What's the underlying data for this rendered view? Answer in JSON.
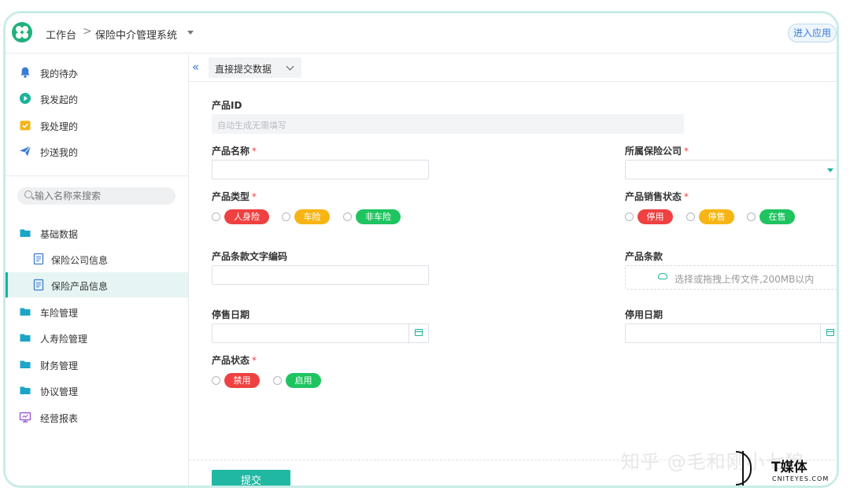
{
  "header": {
    "workspace": "工作台",
    "separator": ">",
    "system": "保险中介管理系统",
    "enter_app": "进入应用"
  },
  "sidebar": {
    "top_items": [
      {
        "label": "我的待办",
        "icon": "bell-icon"
      },
      {
        "label": "我发起的",
        "icon": "play-icon"
      },
      {
        "label": "我处理的",
        "icon": "task-icon"
      },
      {
        "label": "抄送我的",
        "icon": "send-icon"
      }
    ],
    "search_placeholder": "输入名称来搜索",
    "tree": [
      {
        "label": "基础数据",
        "icon": "folder-icon"
      },
      {
        "label": "保险公司信息",
        "icon": "document-icon"
      },
      {
        "label": "保险产品信息",
        "icon": "document-icon",
        "active": true
      },
      {
        "label": "车险管理",
        "icon": "folder-icon"
      },
      {
        "label": "人寿险管理",
        "icon": "folder-icon"
      },
      {
        "label": "财务管理",
        "icon": "folder-icon"
      },
      {
        "label": "协议管理",
        "icon": "folder-icon"
      },
      {
        "label": "经营报表",
        "icon": "monitor-icon"
      }
    ]
  },
  "toolbar": {
    "collapse": "«",
    "view": "直接提交数据"
  },
  "form": {
    "product_id": {
      "label": "产品ID",
      "placeholder": "自动生成无需填写"
    },
    "product_name": {
      "label": "产品名称",
      "required": "*",
      "value": ""
    },
    "insurance_company": {
      "label": "所属保险公司",
      "required": "*",
      "value": ""
    },
    "product_type": {
      "label": "产品类型",
      "required": "*",
      "options": [
        "人身险",
        "车险",
        "非车险"
      ]
    },
    "sales_status": {
      "label": "产品销售状态",
      "required": "*",
      "options": [
        "停用",
        "停售",
        "在售"
      ]
    },
    "clause_code": {
      "label": "产品条款文字编码",
      "value": ""
    },
    "clause": {
      "label": "产品条款",
      "upload_hint": "选择或拖拽上传文件,200MB以内"
    },
    "stop_sale_date": {
      "label": "停售日期",
      "value": ""
    },
    "disable_date": {
      "label": "停用日期",
      "value": ""
    },
    "product_status": {
      "label": "产品状态",
      "required": "*",
      "options": [
        "禁用",
        "启用"
      ]
    },
    "submit": "提交"
  },
  "colors": {
    "accent": "#21b8a3",
    "red": "#ef4141",
    "yellow": "#f7b515",
    "green": "#1ec460",
    "link": "#3a7bd5"
  },
  "watermark": {
    "zhihu": "知乎 @毛和刚小七狼",
    "brand": "T媒体",
    "brand_url": "CNITEYES.COM"
  }
}
